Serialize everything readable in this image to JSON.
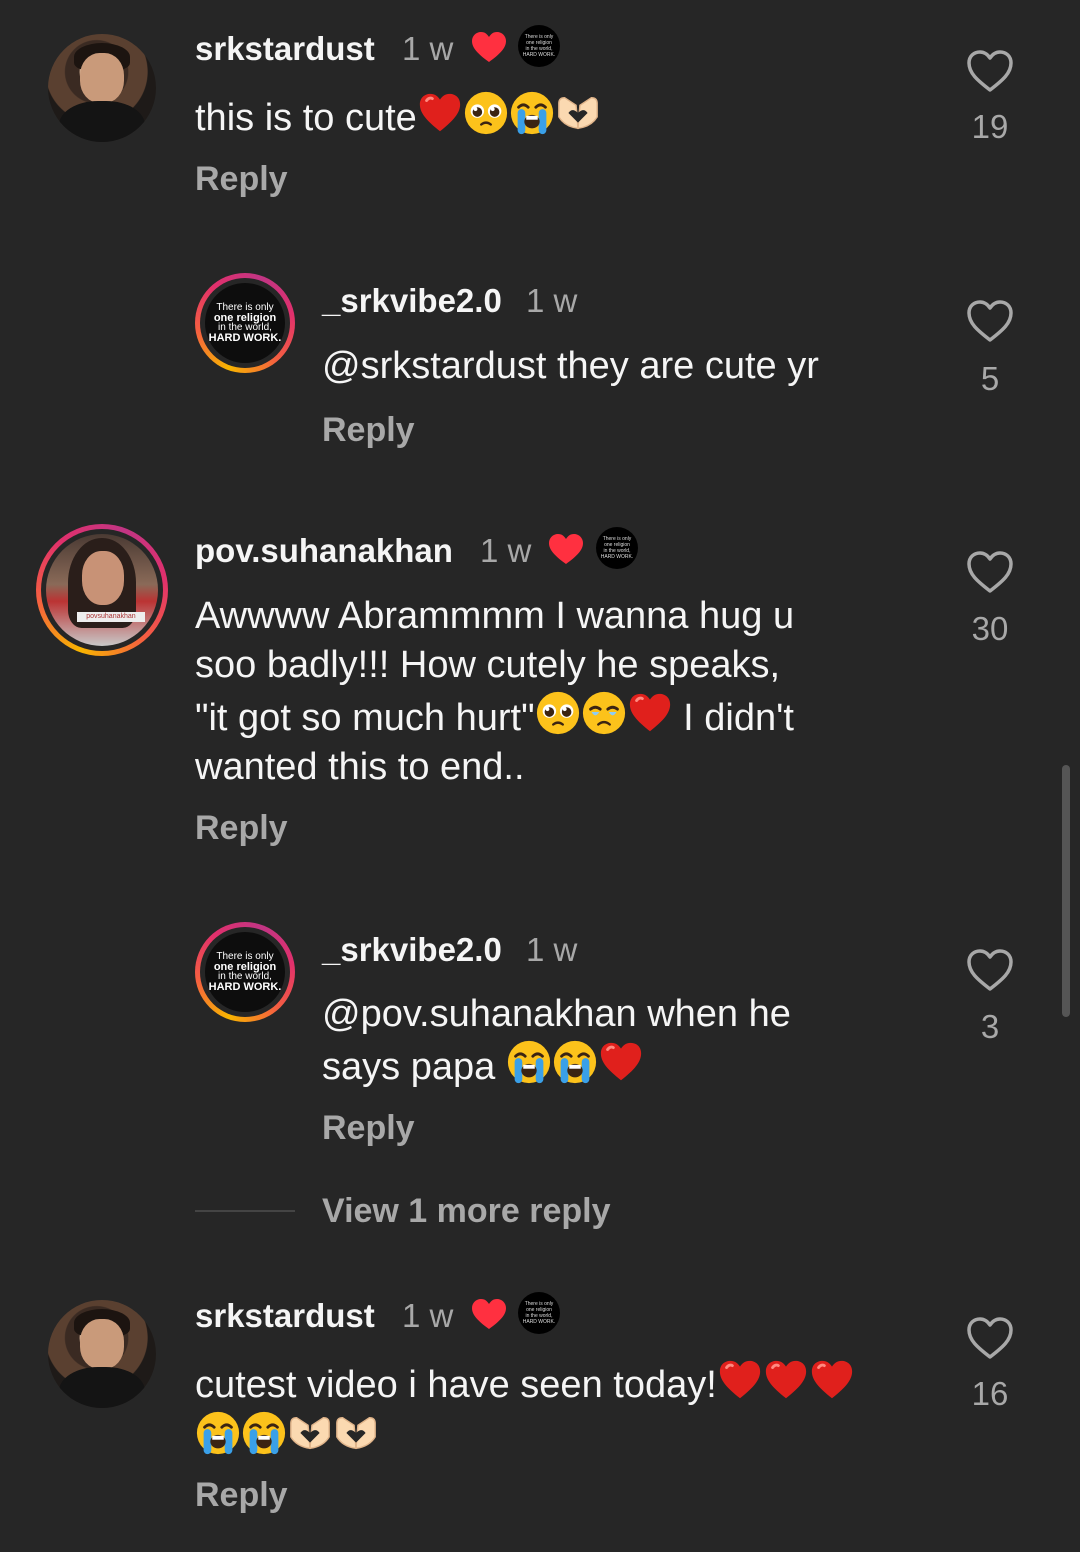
{
  "comments": [
    {
      "username": "srkstardust",
      "time": "1 w",
      "text": "this is to cute",
      "reply": "Reply",
      "likes": "19"
    },
    {
      "username": "_srkvibe2.0",
      "time": "1 w",
      "text": "@srkstardust they are cute yr",
      "reply": "Reply",
      "likes": "5"
    },
    {
      "username": "pov.suhanakhan",
      "time": "1 w",
      "text_line1": "Awwww Abrammmm I wanna hug u",
      "text_line2": "soo badly!!! How cutely he speaks,",
      "text_line3a": "\"it got so much hurt\"",
      "text_line3b": " I didn't",
      "text_line4": "wanted this to end..",
      "reply": "Reply",
      "likes": "30"
    },
    {
      "username": "_srkvibe2.0",
      "time": "1 w",
      "text_line1": "@pov.suhanakhan when he",
      "text_line2": "says papa ",
      "reply": "Reply",
      "likes": "3"
    },
    {
      "username": "srkstardust",
      "time": "1 w",
      "text": "cutest video i have seen today!",
      "reply": "Reply",
      "likes": "16"
    }
  ],
  "view_more": "View 1 more reply",
  "logo": {
    "line1": "There is only",
    "line2": "one religion",
    "line3": "in the world,",
    "line4": "HARD WORK."
  },
  "avatar_caption": "povsuhanakhan",
  "icons": {
    "like": "heart-outline-icon",
    "creator_heart": "red-heart-icon"
  },
  "colors": {
    "background": "#262626",
    "heart": "#ff3040",
    "secondary_text": "#a8a8a8"
  }
}
